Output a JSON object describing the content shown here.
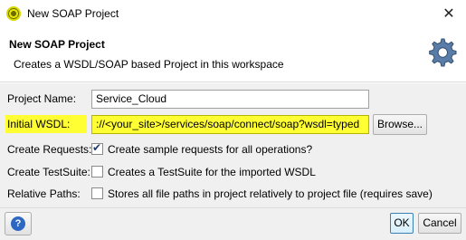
{
  "window": {
    "title": "New SOAP Project",
    "close_glyph": "✕"
  },
  "banner": {
    "title": "New SOAP Project",
    "description": "Creates a WSDL/SOAP based Project in this workspace",
    "icon": "gear-icon"
  },
  "form": {
    "project_name": {
      "label": "Project Name:",
      "value": "Service_Cloud"
    },
    "initial_wsdl": {
      "label": "Initial WSDL:",
      "value": "://<your_site>/services/soap/connect/soap?wsdl=typed",
      "browse_label": "Browse...",
      "highlight_color": "#ffff33"
    },
    "create_requests": {
      "label": "Create Requests:",
      "checked": true,
      "text": "Create sample requests for all operations?"
    },
    "create_testsuite": {
      "label": "Create TestSuite:",
      "checked": false,
      "text": "Creates a TestSuite for the imported WSDL"
    },
    "relative_paths": {
      "label": "Relative Paths:",
      "checked": false,
      "text": "Stores all file paths in project relatively to project file (requires save)"
    }
  },
  "buttons": {
    "help_glyph": "?",
    "ok_label": "OK",
    "cancel_label": "Cancel"
  }
}
